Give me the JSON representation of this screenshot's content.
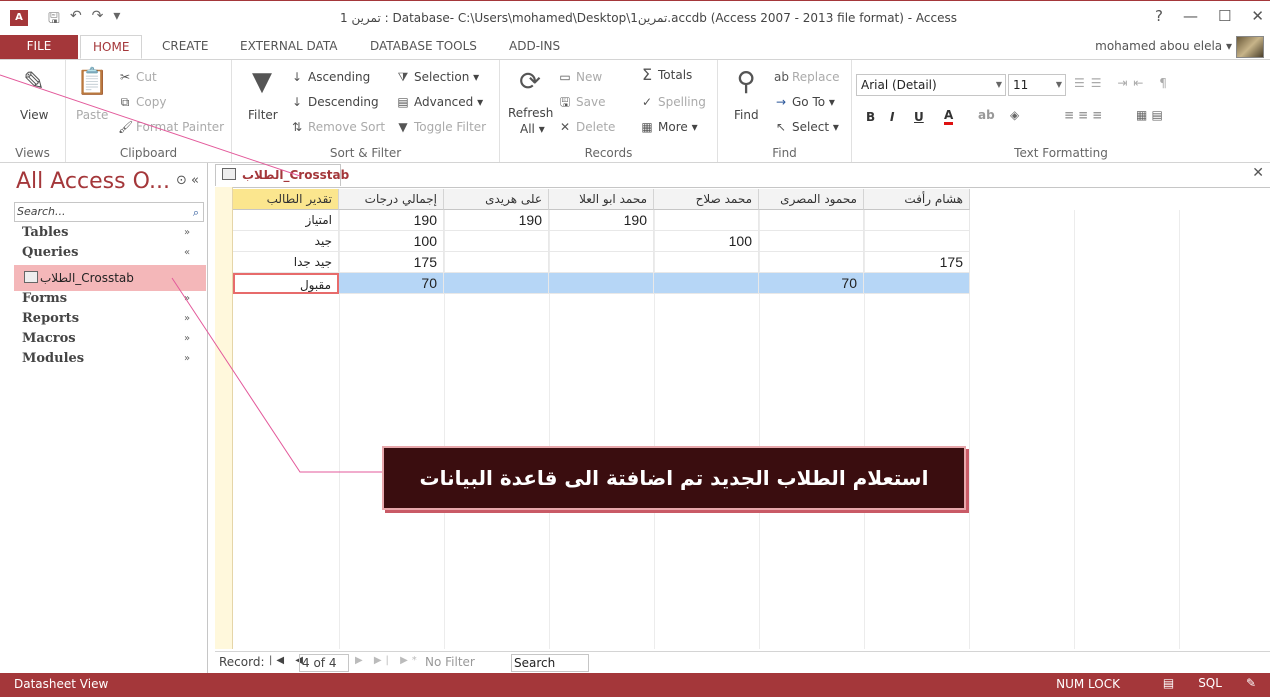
{
  "titlebar": {
    "app_icon": "A",
    "title": "تمرين 1 : Database- C:\\Users\\mohamed\\Desktop\\تمرين1.accdb (Access 2007 - 2013 file format) - Access",
    "help": "?",
    "minimize": "—",
    "restore": "☐",
    "close": "✕"
  },
  "tabs": [
    "FILE",
    "HOME",
    "CREATE",
    "EXTERNAL DATA",
    "DATABASE TOOLS",
    "ADD-INS"
  ],
  "user": "mohamed abou elela ▾",
  "ribbon": {
    "views": {
      "view": "View",
      "label": "Views"
    },
    "clipboard": {
      "paste": "Paste",
      "cut": "Cut",
      "copy": "Copy",
      "format_painter": "Format Painter",
      "label": "Clipboard"
    },
    "sort_filter": {
      "filter": "Filter",
      "ascending": "Ascending",
      "descending": "Descending",
      "remove_sort": "Remove Sort",
      "selection": "Selection ▾",
      "advanced": "Advanced ▾",
      "toggle_filter": "Toggle Filter",
      "label": "Sort & Filter"
    },
    "records": {
      "refresh": "Refresh",
      "refresh_all": "All ▾",
      "new": "New",
      "save": "Save",
      "delete": "Delete",
      "totals": "Totals",
      "spelling": "Spelling",
      "more": "More ▾",
      "label": "Records"
    },
    "find": {
      "find": "Find",
      "replace": "Replace",
      "goto": "Go To ▾",
      "select": "Select ▾",
      "label": "Find"
    },
    "text_formatting": {
      "font": "Arial (Detail)",
      "size": "11",
      "bold": "B",
      "italic": "I",
      "underline": "U",
      "label": "Text Formatting"
    }
  },
  "nav": {
    "title": "All Access O...",
    "search_placeholder": "Search...",
    "groups": [
      {
        "label": "Tables",
        "chev": "»"
      },
      {
        "label": "Queries",
        "chev": "«"
      },
      {
        "label": "Forms",
        "chev": "»"
      },
      {
        "label": "Reports",
        "chev": "»"
      },
      {
        "label": "Macros",
        "chev": "»"
      },
      {
        "label": "Modules",
        "chev": "»"
      }
    ],
    "selected_query": "الطلاب_Crosstab"
  },
  "document": {
    "tab_label": "الطلاب_Crosstab",
    "columns": [
      "تقدير الطالب",
      "إجمالي درجات",
      "على هريدى",
      "محمد ابو العلا",
      "محمد صلاح",
      "محمود المصرى",
      "هشام رأفت"
    ],
    "rows": [
      {
        "grade": "امتياز",
        "total": "190",
        "c2": "190",
        "c3": "190",
        "c4": "",
        "c5": "",
        "c6": ""
      },
      {
        "grade": "جيد",
        "total": "100",
        "c2": "",
        "c3": "",
        "c4": "100",
        "c5": "",
        "c6": ""
      },
      {
        "grade": "جيد جدا",
        "total": "175",
        "c2": "",
        "c3": "",
        "c4": "",
        "c5": "",
        "c6": "175"
      },
      {
        "grade": "مقبول",
        "total": "70",
        "c2": "",
        "c3": "",
        "c4": "",
        "c5": "70",
        "c6": ""
      }
    ]
  },
  "record_nav": {
    "label": "Record:",
    "position": "4 of 4",
    "no_filter": "No Filter",
    "search": "Search"
  },
  "status": {
    "left": "Datasheet View",
    "num_lock": "NUM LOCK",
    "sql": "SQL"
  },
  "callout": "استعلام الطلاب الجديد تم اضافتة الى قاعدة البيانات"
}
